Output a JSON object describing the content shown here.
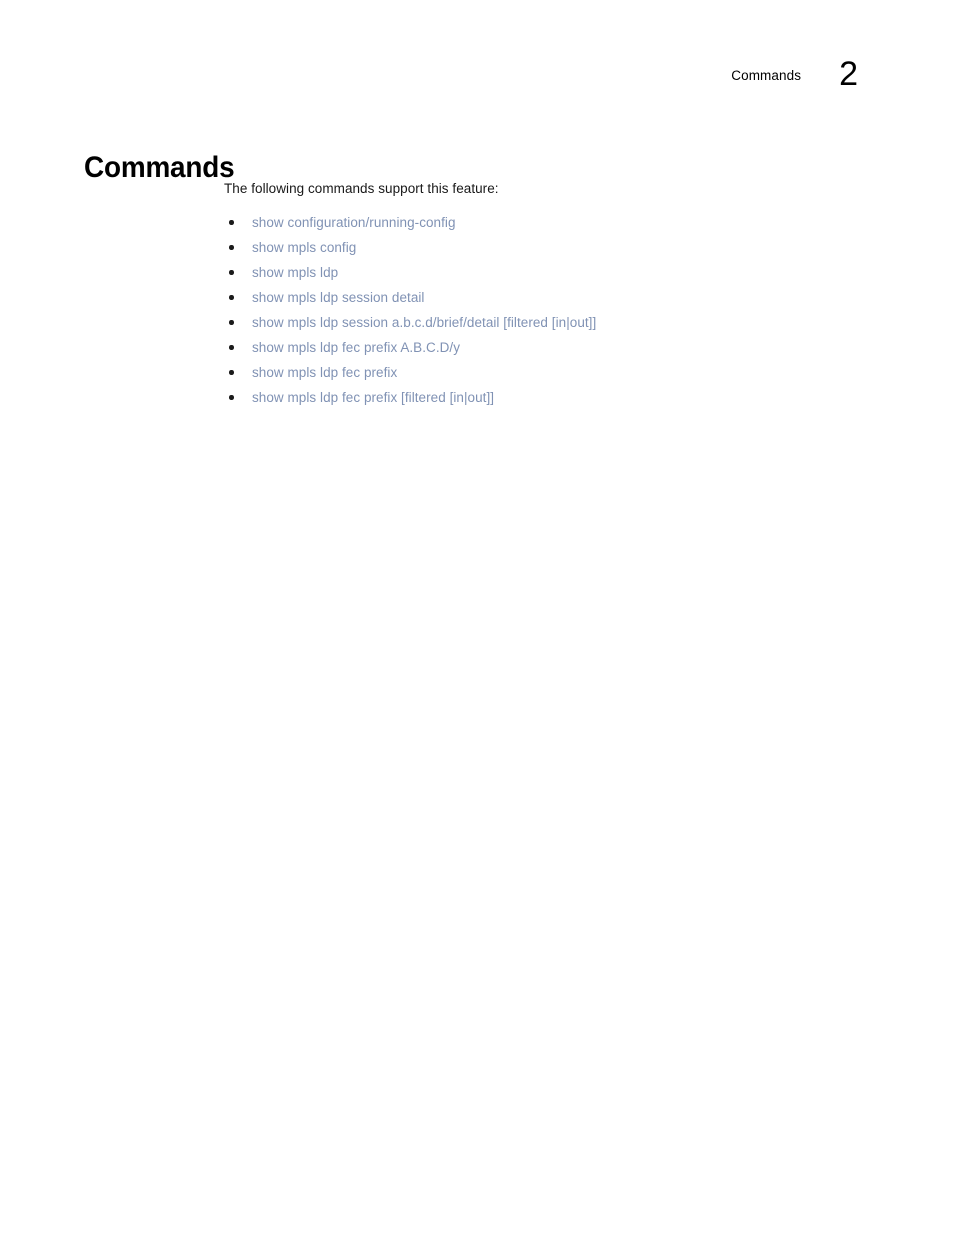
{
  "document": {
    "page_background": "#ffffff"
  },
  "header": {
    "title": "Commands",
    "page_number": "2"
  },
  "section": {
    "title": "Commands"
  },
  "body": {
    "intro": "The following commands support this feature:",
    "commands": [
      {
        "label": "show configuration/running-config"
      },
      {
        "label": "show mpls config"
      },
      {
        "label": "show mpls ldp"
      },
      {
        "label": "show mpls ldp session detail"
      },
      {
        "label": "show mpls ldp session a.b.c.d/brief/detail [filtered [in|out]]"
      },
      {
        "label": "show mpls ldp fec prefix A.B.C.D/y"
      },
      {
        "label": "show mpls ldp fec prefix"
      },
      {
        "label": "show mpls ldp fec prefix [filtered [in|out]]"
      }
    ]
  },
  "colors": {
    "link": "#8092b4",
    "text": "#181818",
    "bullet": "#1a1a1a"
  }
}
